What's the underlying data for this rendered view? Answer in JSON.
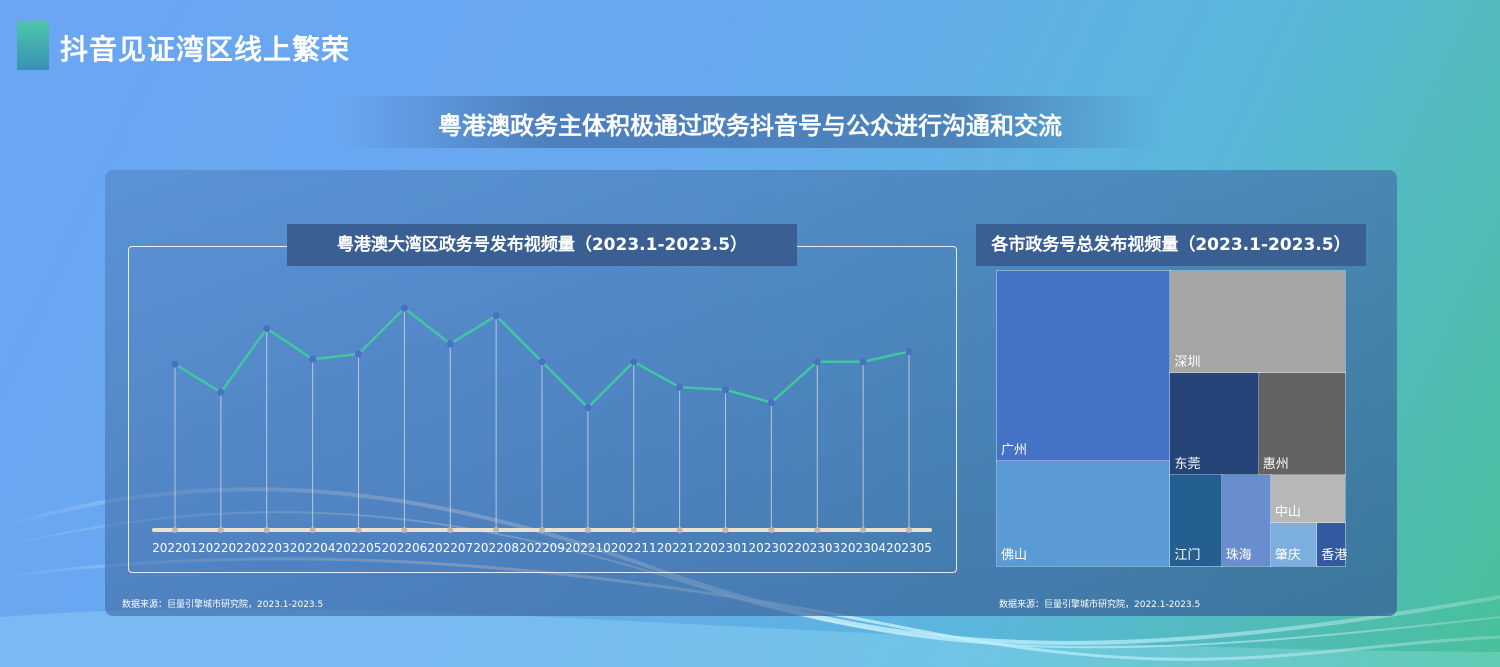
{
  "header": {
    "title": "抖音见证湾区线上繁荣",
    "subtitle": "粤港澳政务主体积极通过政务抖音号与公众进行沟通和交流"
  },
  "chart_data": [
    {
      "type": "line",
      "title": "粤港澳大湾区政务号发布视频量（2023.1-2023.5）",
      "categories": [
        "202201",
        "202202",
        "202203",
        "202204",
        "202205",
        "202206",
        "202207",
        "202208",
        "202209",
        "202210",
        "202211",
        "202212",
        "202301",
        "202302",
        "202303",
        "202304",
        "202305"
      ],
      "values": [
        65,
        54,
        79,
        67,
        69,
        87,
        73,
        84,
        66,
        48,
        66,
        56,
        55,
        50,
        66,
        66,
        70
      ],
      "ylim": [
        0,
        100
      ],
      "grid": false,
      "colors": {
        "line": "#3fc7a0",
        "marker": "#4a6fc4",
        "stem": "#cfd8e3"
      },
      "source": "数据来源：巨量引擎城市研究院，2023.1-2023.5"
    },
    {
      "type": "treemap",
      "title": "各市政务号总发布视频量（2023.1-2023.5）",
      "items": [
        {
          "name": "广州",
          "value": 33.0,
          "color": "#4472c4"
        },
        {
          "name": "深圳",
          "value": 17.8,
          "color": "#a5a5a5"
        },
        {
          "name": "佛山",
          "value": 18.3,
          "color": "#5b9bd5"
        },
        {
          "name": "东莞",
          "value": 9.0,
          "color": "#264478"
        },
        {
          "name": "惠州",
          "value": 8.8,
          "color": "#636363"
        },
        {
          "name": "江门",
          "value": 4.7,
          "color": "#255e91"
        },
        {
          "name": "珠海",
          "value": 4.5,
          "color": "#698ed0"
        },
        {
          "name": "中山",
          "value": 3.6,
          "color": "#b7b7b7"
        },
        {
          "name": "肇庆",
          "value": 2.0,
          "color": "#7cafdd"
        },
        {
          "name": "香港",
          "value": 1.2,
          "color": "#335aa1"
        }
      ],
      "source": "数据来源：巨量引擎城市研究院，2022.1-2023.5"
    }
  ]
}
